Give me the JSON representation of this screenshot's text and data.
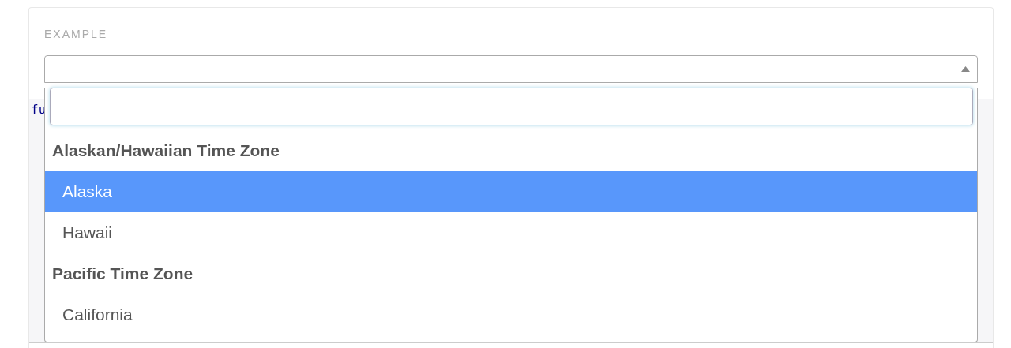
{
  "section_label": "EXAMPLE",
  "code_block": {
    "lines": [
      "fu"
    ]
  },
  "select": {
    "expanded": true,
    "groups": [
      {
        "label": "Alaskan/Hawaiian Time Zone",
        "options": [
          {
            "label": "Alaska",
            "selected": true
          },
          {
            "label": "Hawaii",
            "selected": false
          }
        ]
      },
      {
        "label": "Pacific Time Zone",
        "options": [
          {
            "label": "California",
            "selected": false
          }
        ]
      }
    ]
  }
}
